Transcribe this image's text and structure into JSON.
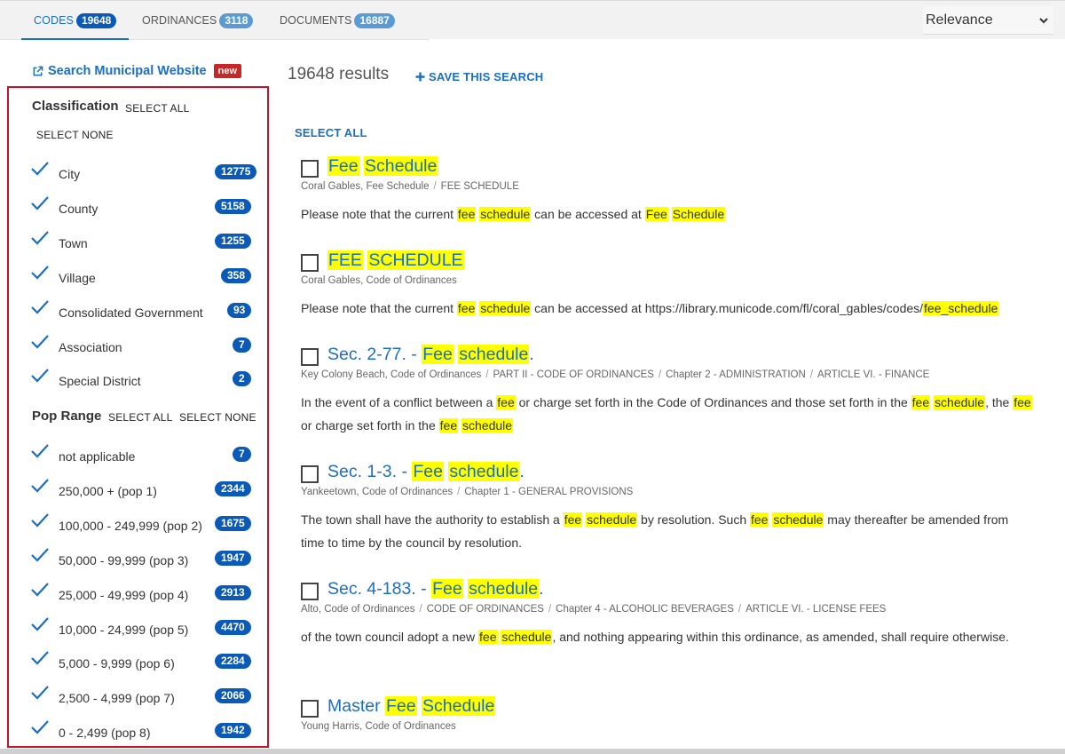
{
  "tabs": [
    {
      "label": "CODES",
      "count": "19648"
    },
    {
      "label": "ORDINANCES",
      "count": "3118"
    },
    {
      "label": "DOCUMENTS",
      "count": "16887"
    }
  ],
  "sort": {
    "value": "Relevance"
  },
  "sidebar": {
    "external_link": "Search Municipal Website",
    "new_badge": "new",
    "classification": {
      "title": "Classification",
      "select_all": "SELECT ALL",
      "select_none": "SELECT NONE",
      "items": [
        {
          "label": "City",
          "count": "12775"
        },
        {
          "label": "County",
          "count": "5158"
        },
        {
          "label": "Town",
          "count": "1255"
        },
        {
          "label": "Village",
          "count": "358"
        },
        {
          "label": "Consolidated Government",
          "count": "93"
        },
        {
          "label": "Association",
          "count": "7"
        },
        {
          "label": "Special District",
          "count": "2"
        }
      ]
    },
    "pop_range": {
      "title": "Pop Range",
      "select_all": "SELECT ALL",
      "select_none": "SELECT NONE",
      "items": [
        {
          "label": "not applicable",
          "count": "7"
        },
        {
          "label": "250,000 + (pop 1)",
          "count": "2344"
        },
        {
          "label": "100,000 - 249,999 (pop 2)",
          "count": "1675"
        },
        {
          "label": "50,000 - 99,999 (pop 3)",
          "count": "1947"
        },
        {
          "label": "25,000 - 49,999 (pop 4)",
          "count": "2913"
        },
        {
          "label": "10,000 - 24,999 (pop 5)",
          "count": "4470"
        },
        {
          "label": "5,000 - 9,999 (pop 6)",
          "count": "2284"
        },
        {
          "label": "2,500 - 4,999 (pop 7)",
          "count": "2066"
        },
        {
          "label": "0 - 2,499 (pop 8)",
          "count": "1942"
        }
      ]
    }
  },
  "results_header": {
    "count_text": "19648 results",
    "save_search": "SAVE THIS SEARCH",
    "select_all": "SELECT ALL"
  },
  "results": [
    {
      "title": [
        {
          "t": "Fee",
          "h": true
        },
        {
          "t": " "
        },
        {
          "t": "Schedule",
          "h": true
        }
      ],
      "crumbs": [
        "Coral Gables, Fee Schedule",
        "FEE SCHEDULE"
      ],
      "snippet": [
        {
          "t": "Please note that the current "
        },
        {
          "t": "fee",
          "h": true
        },
        {
          "t": " "
        },
        {
          "t": "schedule",
          "h": true
        },
        {
          "t": " can be accessed at "
        },
        {
          "t": "Fee",
          "h": true
        },
        {
          "t": " "
        },
        {
          "t": "Schedule",
          "h": true
        }
      ]
    },
    {
      "title": [
        {
          "t": "FEE",
          "h": true
        },
        {
          "t": " "
        },
        {
          "t": "SCHEDULE",
          "h": true
        }
      ],
      "crumbs": [
        "Coral Gables, Code of Ordinances"
      ],
      "snippet": [
        {
          "t": "Please note that the current "
        },
        {
          "t": "fee",
          "h": true
        },
        {
          "t": " "
        },
        {
          "t": "schedule",
          "h": true
        },
        {
          "t": " can be accessed at https://library.municode.com/fl/coral_gables/codes/"
        },
        {
          "t": "fee_schedule",
          "h": true
        }
      ]
    },
    {
      "title": [
        {
          "t": "Sec. 2-77. - "
        },
        {
          "t": "Fee",
          "h": true
        },
        {
          "t": " "
        },
        {
          "t": "schedule",
          "h": true
        },
        {
          "t": "."
        }
      ],
      "crumbs": [
        "Key Colony Beach, Code of Ordinances",
        "PART II - CODE OF ORDINANCES",
        "Chapter 2 - ADMINISTRATION",
        "ARTICLE VI. - FINANCE"
      ],
      "snippet": [
        {
          "t": "In the event of a conflict between a "
        },
        {
          "t": "fee",
          "h": true
        },
        {
          "t": " or charge set forth in the Code of Ordinances and those set forth in the "
        },
        {
          "t": "fee",
          "h": true
        },
        {
          "t": " "
        },
        {
          "t": "schedule",
          "h": true
        },
        {
          "t": ", the "
        },
        {
          "t": "fee",
          "h": true
        },
        {
          "t": " or charge set forth in the "
        },
        {
          "t": "fee",
          "h": true
        },
        {
          "t": " "
        },
        {
          "t": "schedule",
          "h": true
        }
      ]
    },
    {
      "title": [
        {
          "t": "Sec. 1-3. - "
        },
        {
          "t": "Fee",
          "h": true
        },
        {
          "t": " "
        },
        {
          "t": "schedule",
          "h": true
        },
        {
          "t": "."
        }
      ],
      "crumbs": [
        "Yankeetown, Code of Ordinances",
        "Chapter 1 - GENERAL PROVISIONS"
      ],
      "snippet": [
        {
          "t": "The town shall have the authority to establish a "
        },
        {
          "t": "fee",
          "h": true
        },
        {
          "t": " "
        },
        {
          "t": "schedule",
          "h": true
        },
        {
          "t": " by resolution. Such "
        },
        {
          "t": "fee",
          "h": true
        },
        {
          "t": " "
        },
        {
          "t": "schedule",
          "h": true
        },
        {
          "t": " may thereafter be amended from time to time by the council by resolution."
        }
      ]
    },
    {
      "title": [
        {
          "t": "Sec. 4-183. - "
        },
        {
          "t": "Fee",
          "h": true
        },
        {
          "t": " "
        },
        {
          "t": "schedule",
          "h": true
        },
        {
          "t": "."
        }
      ],
      "crumbs": [
        "Alto, Code of Ordinances",
        "CODE OF ORDINANCES",
        "Chapter 4 - ALCOHOLIC BEVERAGES",
        "ARTICLE VI. - LICENSE FEES"
      ],
      "snippet": [
        {
          "t": "of the town council adopt a new "
        },
        {
          "t": "fee",
          "h": true
        },
        {
          "t": " "
        },
        {
          "t": "schedule",
          "h": true
        },
        {
          "t": ", and nothing appearing within this ordinance, as amended, shall require otherwise."
        }
      ]
    },
    {
      "title": [
        {
          "t": "Master "
        },
        {
          "t": "Fee",
          "h": true
        },
        {
          "t": " "
        },
        {
          "t": "Schedule",
          "h": true
        }
      ],
      "crumbs": [
        "Young Harris, Code of Ordinances"
      ],
      "snippet": []
    }
  ]
}
